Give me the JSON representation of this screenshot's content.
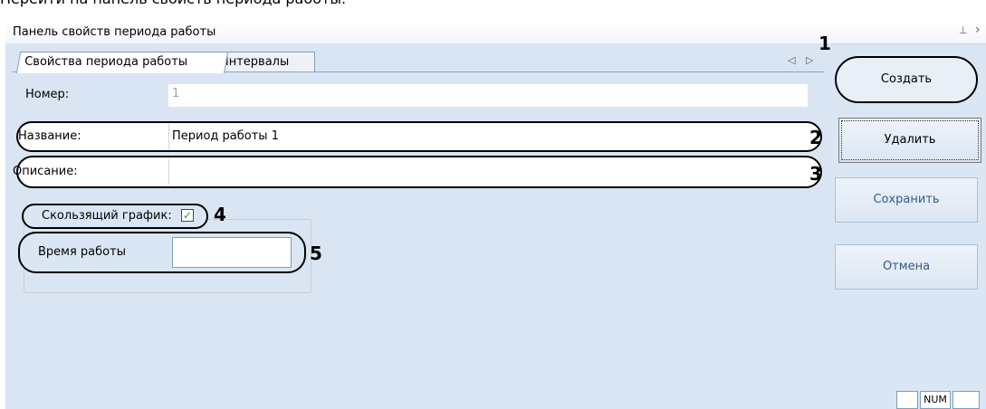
{
  "caption": "Перейти на панель свойств периода работы.",
  "panel": {
    "title": "Панель свойств периода работы",
    "pin_icon": "pin-icon",
    "close_icon": "close-icon"
  },
  "tabs": [
    {
      "label": "Свойства периода работы",
      "active": true
    },
    {
      "label": "Интервалы",
      "active": false
    }
  ],
  "tab_nav": {
    "left": "◁",
    "right": "▷"
  },
  "form": {
    "number": {
      "label": "Номер:",
      "value": "1"
    },
    "name": {
      "label": "Название:",
      "value": "Период работы 1"
    },
    "description": {
      "label": "Описание:",
      "value": ""
    },
    "sliding": {
      "label": "Скользящий график:",
      "checked": true,
      "check_glyph": "✓"
    },
    "work_time": {
      "label": "Время работы",
      "value": ""
    }
  },
  "annotations": [
    "1",
    "2",
    "3",
    "4",
    "5"
  ],
  "buttons": {
    "create": "Создать",
    "delete": "Удалить",
    "save": "Сохранить",
    "cancel": "Отмена"
  },
  "statusbar": {
    "num": "NUM"
  },
  "colors": {
    "panel_bg": "#dae6f3",
    "tab_border": "#7f9db9",
    "checkbox_check": "#21a121"
  }
}
